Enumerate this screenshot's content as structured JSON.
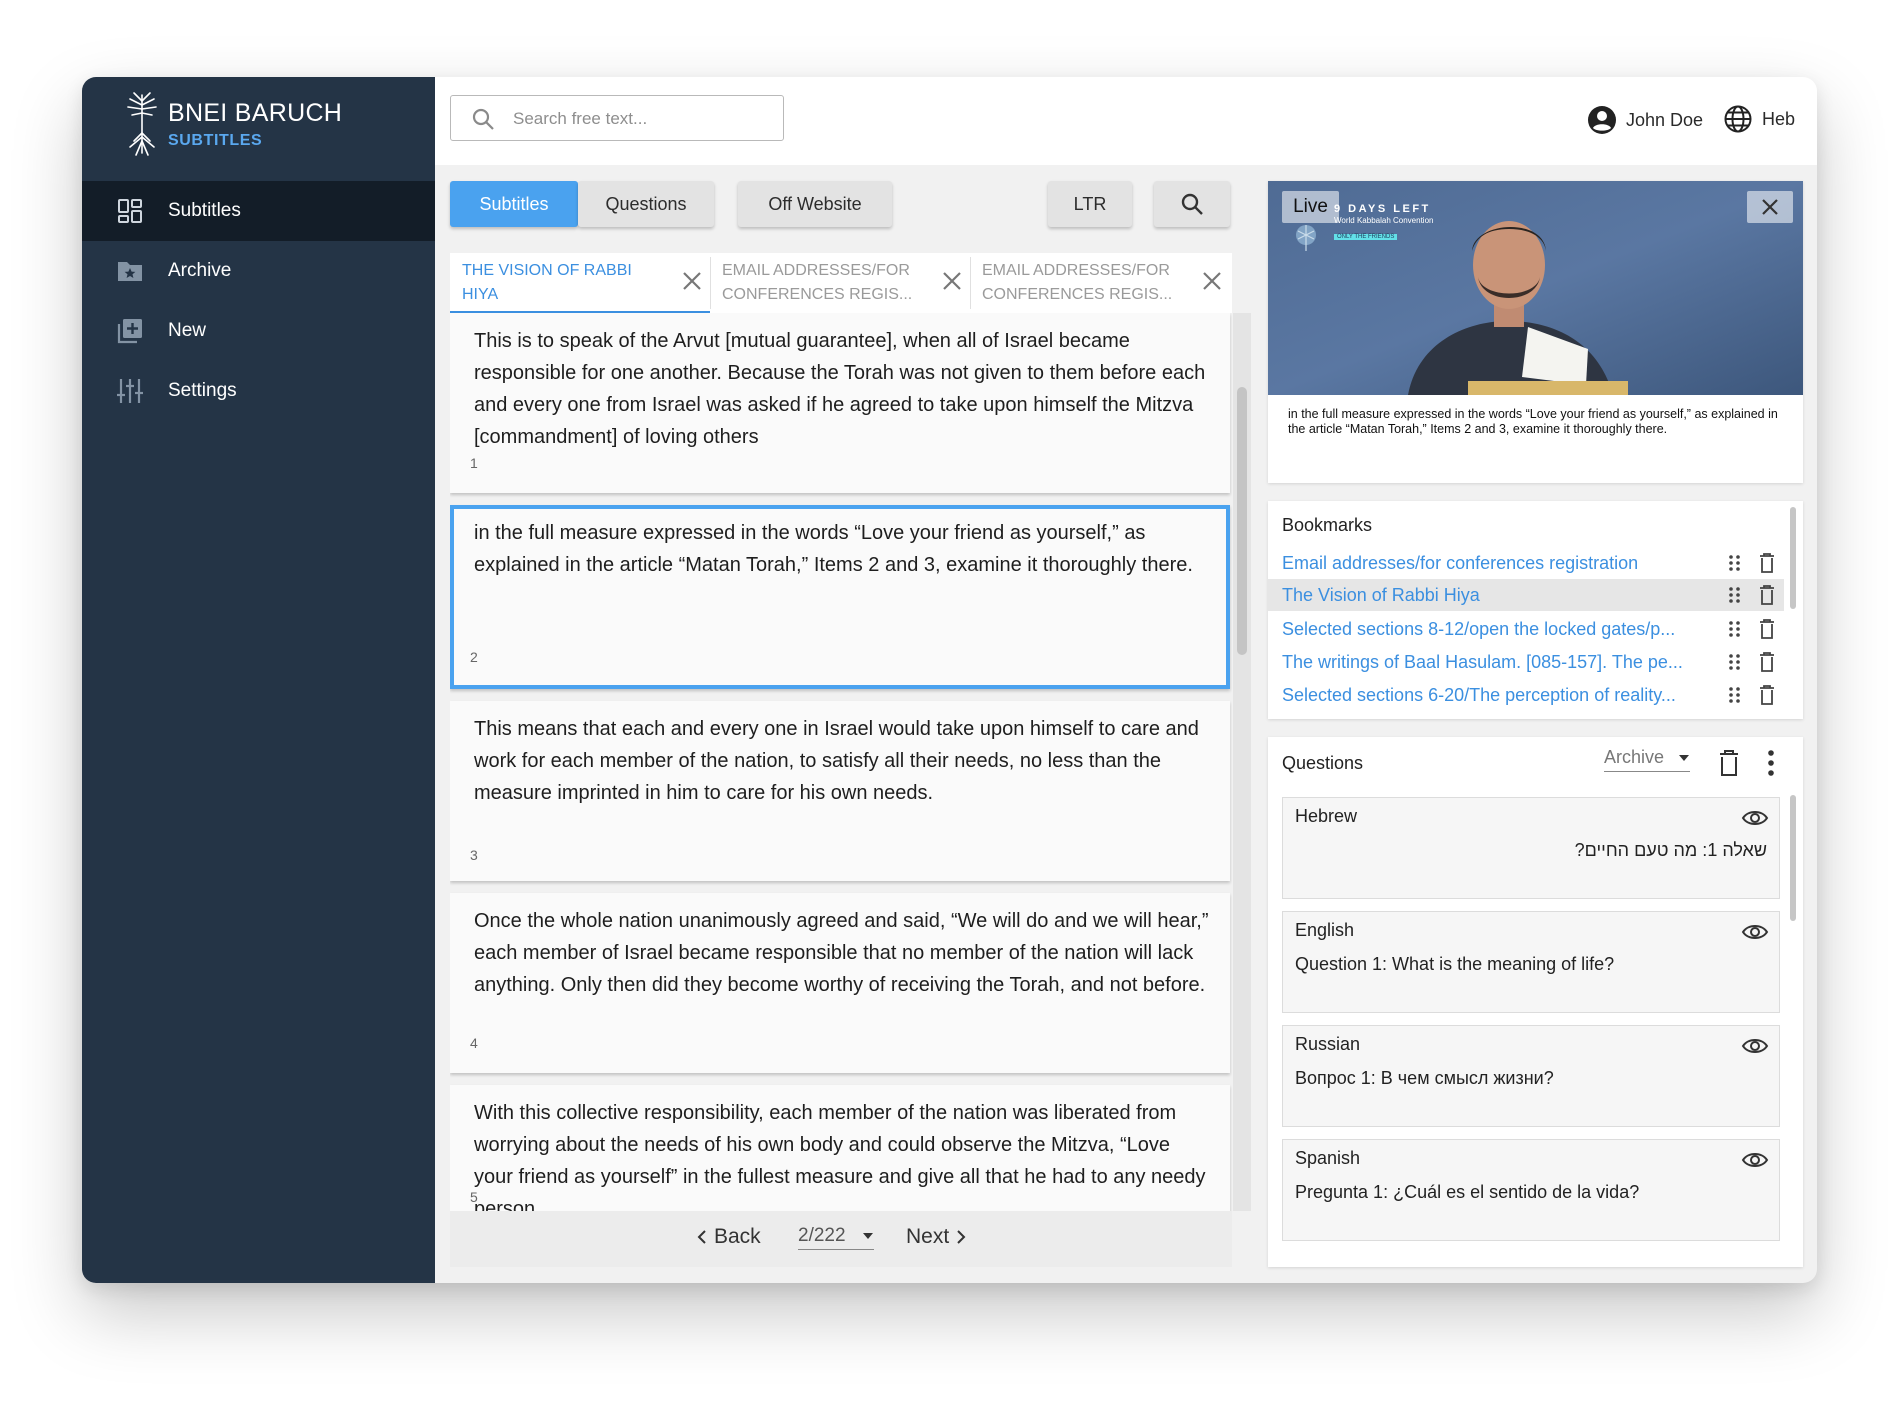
{
  "brand": {
    "title": "BNEI BARUCH",
    "subtitle": "SUBTITLES"
  },
  "sidebar": {
    "items": [
      {
        "label": "Subtitles",
        "icon": "dashboard-icon",
        "active": true
      },
      {
        "label": "Archive",
        "icon": "folder-star-icon",
        "active": false
      },
      {
        "label": "New",
        "icon": "add-box-icon",
        "active": false
      },
      {
        "label": "Settings",
        "icon": "sliders-icon",
        "active": false
      }
    ]
  },
  "search": {
    "placeholder": "Search free text..."
  },
  "user": {
    "name": "John Doe",
    "language": "Heb"
  },
  "toolbar": {
    "subtitles": "Subtitles",
    "questions": "Questions",
    "off_website": "Off Website",
    "direction": "LTR"
  },
  "tabs": [
    {
      "label": "THE VISION OF RABBI HIYA",
      "active": true
    },
    {
      "label": "EMAIL ADDRESSES/FOR CONFERENCES REGIS...",
      "active": false
    },
    {
      "label": "EMAIL ADDRESSES/FOR CONFERENCES REGIS...",
      "active": false
    }
  ],
  "subtitles": [
    {
      "text": "This is to speak of the Arvut [mutual guarantee], when all of Israel became responsible for one another. Because the Torah was not given to them before each and every one from Israel was asked if he agreed to take upon himself the Mitzva [commandment] of loving others",
      "number": "1"
    },
    {
      "text": "in the full measure expressed in the words “Love your friend as yourself,” as explained in the article “Matan Torah,” Items 2 and 3, examine it thoroughly there.",
      "number": "2"
    },
    {
      "text": "This means that each and every one in Israel would take upon himself to care and work for each member of the nation, to satisfy all their needs, no less than the measure imprinted in him to care for his own needs.",
      "number": "3"
    },
    {
      "text": "Once the whole nation unanimously agreed and said, “We will do and we will hear,” each member of Israel became responsible that no member of the nation will lack anything. Only then did they become worthy of receiving the Torah, and not before.",
      "number": "4"
    },
    {
      "text": "With this collective responsibility, each member of the nation was liberated from worrying about the needs of his own body and could observe the Mitzva, “Love your friend as yourself” in the fullest measure and give all that he had to any needy person",
      "number": "5"
    }
  ],
  "pager": {
    "back": "Back",
    "next": "Next",
    "page": "2/222"
  },
  "video": {
    "live": "Live",
    "banner_days": "9 DAYS LEFT",
    "banner_event": "World Kabbalah Convention",
    "banner_tag": "ONLY THE FRIENDS",
    "caption": "in the full measure expressed in the words “Love your friend as yourself,” as explained in the article “Matan Torah,” Items 2 and 3, examine it thoroughly there."
  },
  "bookmarks": {
    "title": "Bookmarks",
    "items": [
      {
        "label": "Email addresses/for conferences registration",
        "active": false
      },
      {
        "label": "The Vision of Rabbi Hiya",
        "active": true
      },
      {
        "label": "Selected sections 8-12/open the locked gates/p...",
        "active": false
      },
      {
        "label": "The writings of Baal Hasulam. [085-157]. The pe...",
        "active": false
      },
      {
        "label": "Selected sections 6-20/The perception of reality...",
        "active": false
      }
    ]
  },
  "questions": {
    "title": "Questions",
    "filter": "Archive",
    "items": [
      {
        "language": "Hebrew",
        "text": "שאלה 1: מה טעם החיים?",
        "rtl": true
      },
      {
        "language": "English",
        "text": "Question 1: What is the meaning of life?",
        "rtl": false
      },
      {
        "language": "Russian",
        "text": "Вопрос 1: В чем смысл жизни?",
        "rtl": false
      },
      {
        "language": "Spanish",
        "text": "Pregunta 1: ¿Cuál es el sentido de la vida?",
        "rtl": false
      }
    ]
  },
  "colors": {
    "accent": "#4aa2ef",
    "sidebar": "#243446",
    "sidebar_active": "#131d28",
    "link": "#3b8fe0"
  }
}
